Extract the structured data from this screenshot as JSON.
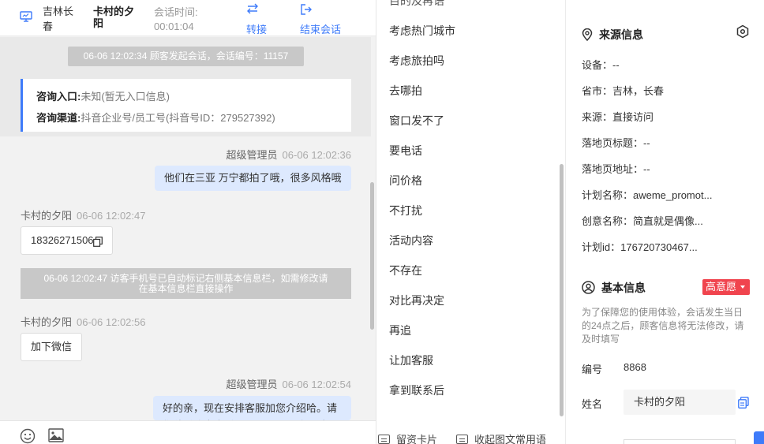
{
  "header": {
    "city": "吉林长春",
    "visitor_name": "卡村的夕阳",
    "time_label": "会话时间:",
    "time_value": "00:01:04",
    "transfer_label": "转接",
    "end_label": "结束会话"
  },
  "chat": {
    "start_notice": "06-06 12:02:34 顾客发起会话，会话编号：11157",
    "entry_label": "咨询入口:",
    "entry_value": "未知(暂无入口信息)",
    "channel_label": "咨询渠道:",
    "channel_value": "抖音企业号/员工号(抖音号ID：279527392)",
    "messages": [
      {
        "sender": "超级管理员",
        "time": "06-06 12:02:36",
        "text": "他们在三亚 万宁都拍了哦，很多风格哦"
      },
      {
        "sender": "卡村的夕阳",
        "time": "06-06 12:02:47",
        "text": "18326271506"
      },
      {
        "sender": "卡村的夕阳",
        "time": "06-06 12:02:56",
        "text": "加下微信"
      },
      {
        "sender": "超级管理员",
        "time": "06-06 12:02:54",
        "text": "好的亲，现在安排客服加您介绍哈。请您稍后注意查看，下“通讯录”-“新朋友”"
      }
    ],
    "phone_notice_line1": "06-06 12:02:47 访客手机号已自动标记右侧基本信息栏，如需修改请",
    "phone_notice_line2": "在基本信息栏直接操作"
  },
  "input_bar": {
    "icons": [
      "emoji-icon",
      "image-icon"
    ]
  },
  "quick_replies": {
    "partial_top": "目的及再语",
    "items": [
      "考虑热门城市",
      "考虑旅拍吗",
      "去哪拍",
      "窗口发不了",
      "要电话",
      "问价格",
      "不打扰",
      "活动内容",
      "不存在",
      "对比再决定",
      "再追",
      "让加客服",
      "拿到联系后"
    ],
    "bottom_card_label": "留资卡片",
    "bottom_common_label": "收起图文常用语"
  },
  "source_info": {
    "title": "来源信息",
    "device": "设备：--",
    "province_city": "省市：吉林，长春",
    "source": "来源：直接访问",
    "landing_title": "落地页标题：--",
    "landing_url": "落地页地址：--",
    "plan_name": "计划名称：aweme_promot...",
    "creative_name": "创意名称：简直就是偶像...",
    "plan_id": "计划id：176720730467..."
  },
  "basic_info": {
    "title": "基本信息",
    "intent_badge": "高意愿",
    "hint": "为了保障您的使用体验，会话发生当日的24点之后，顾客信息将无法修改，请及时填写",
    "number_label": "编号",
    "number_value": "8868",
    "name_label": "姓名",
    "name_value": "卡村的夕阳"
  },
  "colors": {
    "accent": "#3e7bfa",
    "badge": "#f0444e",
    "bubble_blue": "#dde9fe"
  }
}
